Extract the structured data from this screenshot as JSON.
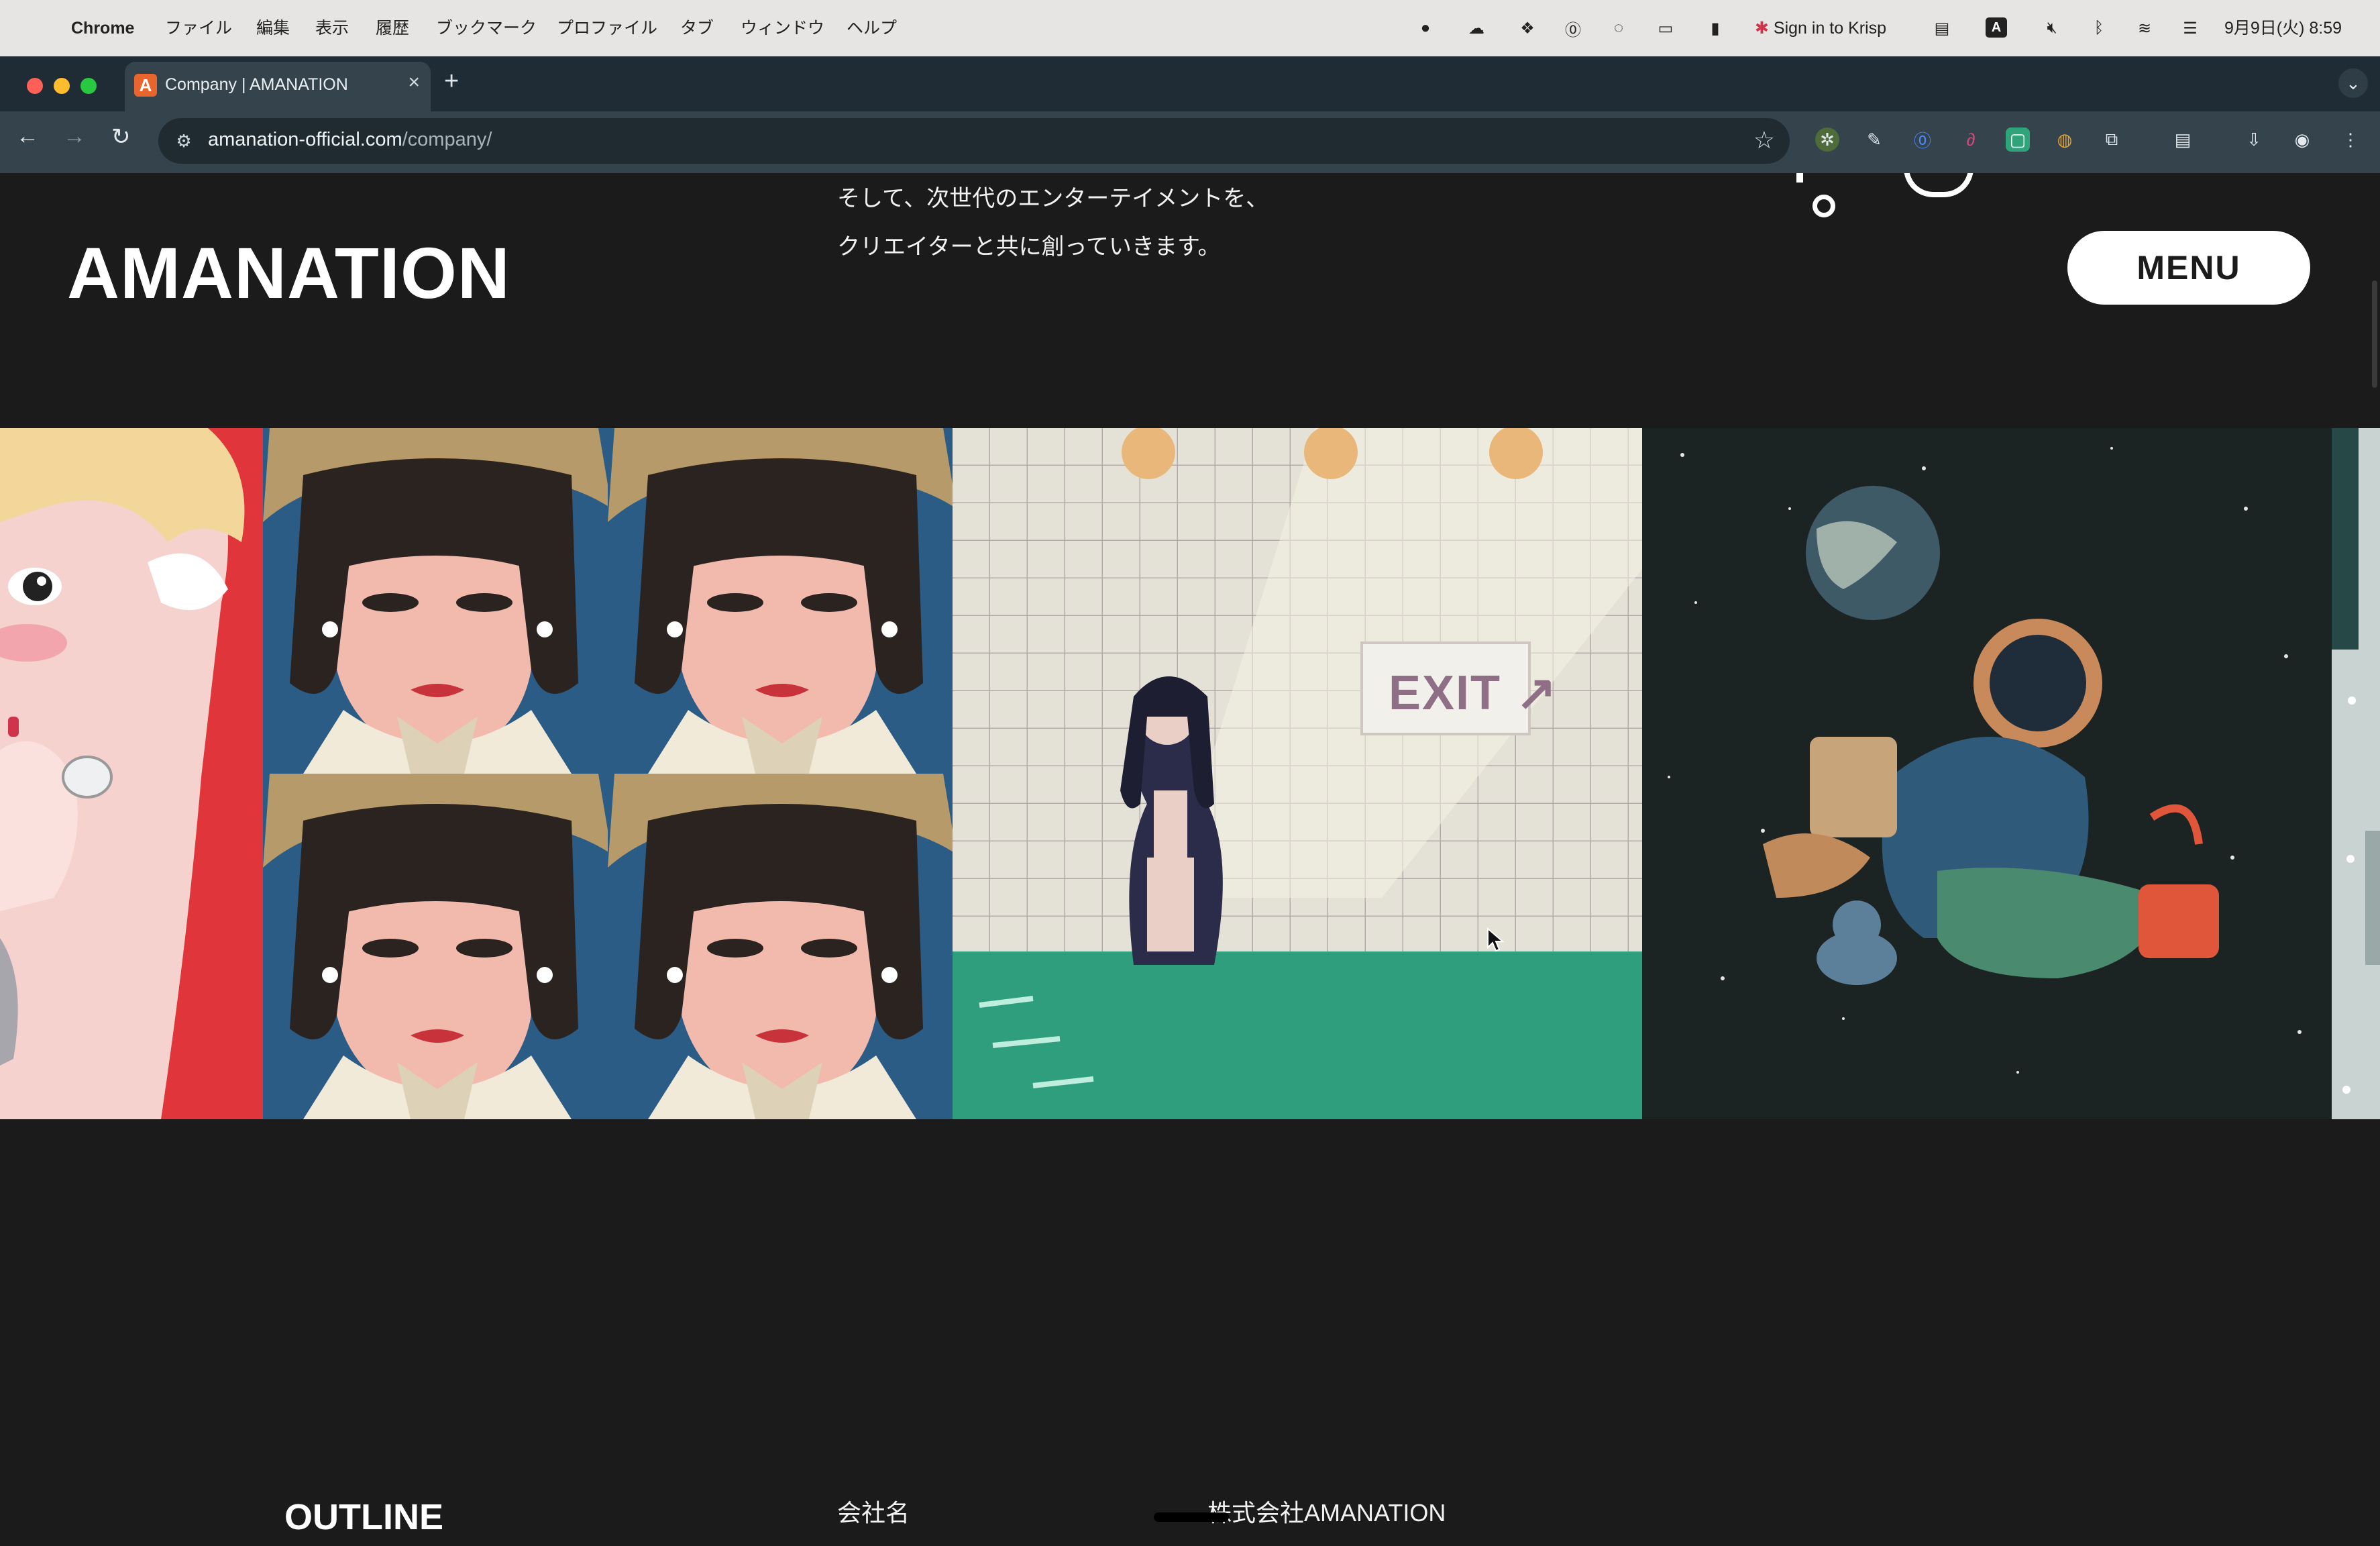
{
  "menubar": {
    "app_name": "Chrome",
    "menus": [
      "ファイル",
      "編集",
      "表示",
      "履歴",
      "ブックマーク",
      "プロファイル",
      "タブ",
      "ウィンドウ",
      "ヘルプ"
    ],
    "krisp_label": "Sign in to Krisp",
    "datetime": "9月9日(火) 8:59"
  },
  "browser": {
    "tab_title": "Company | AMANATION",
    "url_host": "amanation-official.com",
    "url_path": "/company/"
  },
  "page": {
    "logo": "AMANATION",
    "intro_lines": [
      "そして、次世代のエンターテイメントを、",
      "クリエイターと共に創っていきます。"
    ],
    "menu_label": "MENU",
    "exit_sign": "EXIT ↗",
    "outline_title": "OUTLINE",
    "outline_rows": [
      {
        "label": "会社名",
        "value": "株式会社AMANATION"
      }
    ]
  },
  "colors": {
    "page_bg": "#1b1b1b",
    "menu_button_bg": "#ffffff",
    "tab_favicon": "#e8662d",
    "poster_red": "#e0353a",
    "pool_green": "#2f9e7c",
    "space_bg": "#1c2323"
  }
}
